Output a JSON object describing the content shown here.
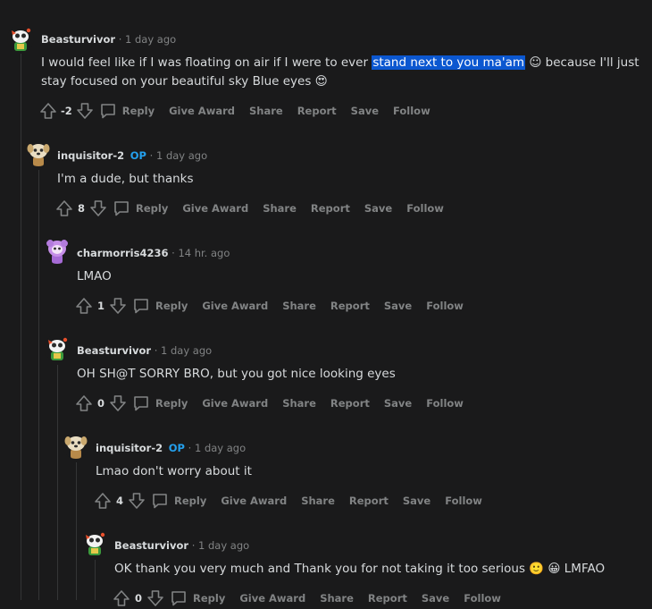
{
  "comments": [
    {
      "author": "Beasturvivor",
      "op": "",
      "time": "1 day ago",
      "text_before": "I would feel like if I was floating on air if I were to ever ",
      "text_highlight": "stand next to you ma'am",
      "text_after": " ☺ because I'll just stay focused on your beautiful sky Blue eyes 😍",
      "score": "-2",
      "avatar": "robot-avatar"
    },
    {
      "author": "inquisitor-2",
      "op": "OP",
      "time": "1 day ago",
      "text": "I'm a dude, but thanks",
      "score": "8",
      "avatar": "dog-avatar"
    },
    {
      "author": "charmorris4236",
      "op": "",
      "time": "14 hr. ago",
      "text": "LMAO",
      "score": "1",
      "avatar": "purple-avatar"
    },
    {
      "author": "Beasturvivor",
      "op": "",
      "time": "1 day ago",
      "text": "OH SH@T SORRY BRO, but you got nice looking eyes",
      "score": "0",
      "avatar": "robot-avatar"
    },
    {
      "author": "inquisitor-2",
      "op": "OP",
      "time": "1 day ago",
      "text": "Lmao don't worry about it",
      "score": "4",
      "avatar": "dog-avatar"
    },
    {
      "author": "Beasturvivor",
      "op": "",
      "time": "1 day ago",
      "text": "OK thank you very much and Thank you for not taking it too serious 🙂  😀  LMFAO",
      "score": "0",
      "avatar": "robot-avatar"
    }
  ],
  "actions": {
    "reply": "Reply",
    "give_award": "Give Award",
    "share": "Share",
    "report": "Report",
    "save": "Save",
    "follow": "Follow"
  },
  "separator": "·",
  "colors": {
    "background": "#1a1a1b",
    "text": "#d7dadc",
    "muted": "#818384",
    "op_badge": "#24a0ed",
    "highlight": "#0b57d0"
  }
}
